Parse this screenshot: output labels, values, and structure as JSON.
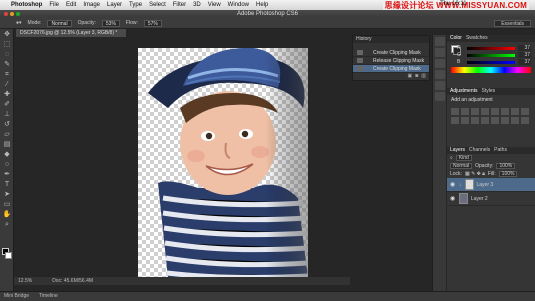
{
  "menubar": {
    "app": "Photoshop",
    "items": [
      "File",
      "Edit",
      "Image",
      "Layer",
      "Type",
      "Select",
      "Filter",
      "3D",
      "View",
      "Window",
      "Help"
    ],
    "clock": "Thu 16:11",
    "watermark": "思缘设计论坛 WWW.MISSYUAN.COM"
  },
  "window": {
    "title": "Adobe Photoshop CS6"
  },
  "options": {
    "mode_label": "Mode:",
    "mode_value": "Normal",
    "opacity_label": "Opacity:",
    "opacity_value": "53%",
    "flow_label": "Flow:",
    "flow_value": "57%",
    "workspace": "Essentials"
  },
  "document": {
    "tab": "DSCF2076.jpg @ 12.5% (Layer 3, RGB/8) *",
    "zoom": "12.5%",
    "doc_size": "Doc: 45.6M/56.4M"
  },
  "bottom_tabs": [
    "Mini Bridge",
    "Timeline"
  ],
  "history": {
    "tab": "History",
    "items": [
      {
        "label": "Create Clipping Mask",
        "selected": false
      },
      {
        "label": "Release Clipping Mask",
        "selected": false
      },
      {
        "label": "Create Clipping Mask",
        "selected": true
      }
    ]
  },
  "color_panel": {
    "tabs": [
      "Color",
      "Swatches"
    ],
    "channels": [
      {
        "label": "R",
        "value": "37"
      },
      {
        "label": "G",
        "value": "37"
      },
      {
        "label": "B",
        "value": "37"
      }
    ]
  },
  "adjustments": {
    "tabs": [
      "Adjustments",
      "Styles"
    ],
    "heading": "Add an adjustment"
  },
  "layers_panel": {
    "tabs": [
      "Layers",
      "Channels",
      "Paths"
    ],
    "kind_label": "Kind",
    "blend_mode": "Normal",
    "opacity_label": "Opacity:",
    "opacity_value": "100%",
    "lock_label": "Lock:",
    "fill_label": "Fill:",
    "fill_value": "100%",
    "layers": [
      {
        "name": "Layer 3",
        "selected": true
      },
      {
        "name": "Layer 2",
        "selected": false
      }
    ]
  },
  "colors": {
    "accent": "#4d6a8a",
    "panel": "#353535"
  }
}
